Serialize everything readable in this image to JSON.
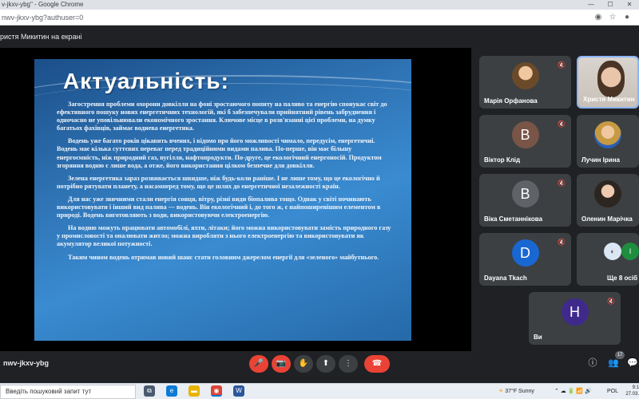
{
  "browser": {
    "title": "v-jkxv-ybg\" - Google Chrome",
    "url": "nwv-jkxv-ybg?authuser=0",
    "controls": {
      "minimize": "—",
      "maximize": "☐",
      "close": "✕"
    }
  },
  "meet": {
    "presenter_label": "ристя Микитин на екрані",
    "meeting_code": "nwv-jkxv-ybg",
    "participants_badge": "17"
  },
  "slide": {
    "title": "Актуальність:",
    "paragraphs": [
      "Загострення проблеми охорони довкілля на фоні зростаючого попиту на паливо та енергію спонукає світ до ефективного пошуку нових енергетичних технологій, які б забезпечували прийнятний рівень забруднення і одночасно не уповільнювали економічного зростання. Ключове місце в розв'язанні цієї проблеми, на думку багатьох фахівців, займає водиева енергетика.",
      "Водень уже багато років цікавить вчених, і відомо про його можливості чимало, передусім, енергетичні. Водень має кілька суттєвих переваг перед традиційними видами палива. По-перше, він має більшу енергоємність, ніж природний газ, вугілля, нафтопродукти. По-друге, це екологічний енергоносій. Продуктом згоряння водню є лише вода, а отже, його використання цілком безпечне для довкілля.",
      "Зелена енергетика зараз розвивається швидше, ніж будь-коли раніше. І не лише тому, що це екологічно й потрібно рятувати планету, а насамперед тому, що це шлях до енергетичної незалежності країн.",
      "Для нас уже звичними стали енергія сонця, вітру, різні види біопалива тощо. Однак у світі починають використовувати і інший вид палива — водень. Він екологічний і, до того ж, є найпоширенішим елементом в природі. Водень виготовляють з води, використовуючи електроенергію.",
      "На водню можуть працювати автомобілі, яхти, літаки; його можна використовувати замість природного газу у промисловості та опалювати житло; можна виробляти з нього електроенергію та використовувати як акумулятор великої потужності.",
      "Таким чином водень отримав новий шанс стати головним джерелом енергії для «зеленого» майбутнього."
    ]
  },
  "participants": [
    {
      "name": "Марія Орфанова",
      "initial": "",
      "muted": true
    },
    {
      "name": "Христя Микитин",
      "initial": "",
      "muted": false
    },
    {
      "name": "Віктор Клід",
      "initial": "В",
      "muted": true
    },
    {
      "name": "Лучин Ірина",
      "initial": "",
      "muted": false
    },
    {
      "name": "Віка Сметаннікова",
      "initial": "В",
      "muted": true
    },
    {
      "name": "Оленин Марічка",
      "initial": "",
      "muted": false
    },
    {
      "name": "Dayana Tkach",
      "initial": "D",
      "muted": true
    },
    {
      "name": "Ще 8 осіб",
      "initial": "І",
      "muted": false
    },
    {
      "name": "Ви",
      "initial": "Н",
      "muted": true
    }
  ],
  "colors": {
    "avatar_brown": "#795548",
    "avatar_gray": "#5f6368",
    "avatar_blue": "#1967d2",
    "avatar_purple": "#3f2a8c",
    "hangup_red": "#ea4335"
  },
  "controls": {
    "mic": "🎤",
    "camera": "📷",
    "raise_hand": "✋",
    "present": "⬆",
    "more": "⋮",
    "hangup": "☎",
    "info": "ⓘ",
    "people": "👥",
    "chat": "💬"
  },
  "taskbar": {
    "search_placeholder": "Введіть пошуковий запит тут",
    "weather": "37°F  Sunny",
    "lang": "POL",
    "time": "9:1",
    "date": "27.03."
  }
}
